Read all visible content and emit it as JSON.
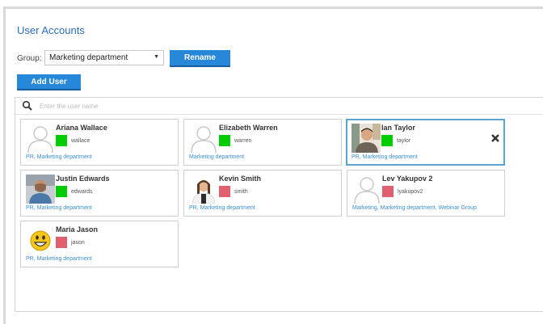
{
  "page_title": "User Accounts",
  "group": {
    "label": "Group:",
    "selected": "Marketing department"
  },
  "buttons": {
    "rename": "Rename",
    "add_user": "Add User"
  },
  "search": {
    "placeholder": "Enter the user name",
    "value": ""
  },
  "colors": {
    "accent": "#2787d8",
    "online": "#00cc00",
    "offline": "#e06070",
    "link": "#3b8fd0",
    "selected_border": "#5aa5d0"
  },
  "users": [
    {
      "name": "Ariana Wallace",
      "login": "wallace",
      "groups": "PR, Marketing department",
      "status": "online",
      "avatar": "placeholder-avatar-icon"
    },
    {
      "name": "Elizabeth Warren",
      "login": "warren",
      "groups": "Marketing department",
      "status": "online",
      "avatar": "placeholder-avatar-icon"
    },
    {
      "name": "Ian Taylor",
      "login": "taylor",
      "groups": "PR, Marketing department",
      "status": "online",
      "avatar": "user-photo",
      "selected": true
    },
    {
      "name": "Justin Edwards",
      "login": "edwards",
      "groups": "PR, Marketing department",
      "status": "online",
      "avatar": "user-photo"
    },
    {
      "name": "Kevin Smith",
      "login": "smith",
      "groups": "PR, Marketing department",
      "status": "offline",
      "avatar": "user-photo"
    },
    {
      "name": "Lev Yakupov 2",
      "login": "lyakupov2",
      "groups": "Marketing, Marketing department, Webinar Group",
      "status": "offline",
      "avatar": "placeholder-avatar-icon"
    },
    {
      "name": "Maria Jason",
      "login": "jason",
      "groups": "PR, Marketing department",
      "status": "offline",
      "avatar": "smiley-icon"
    }
  ]
}
